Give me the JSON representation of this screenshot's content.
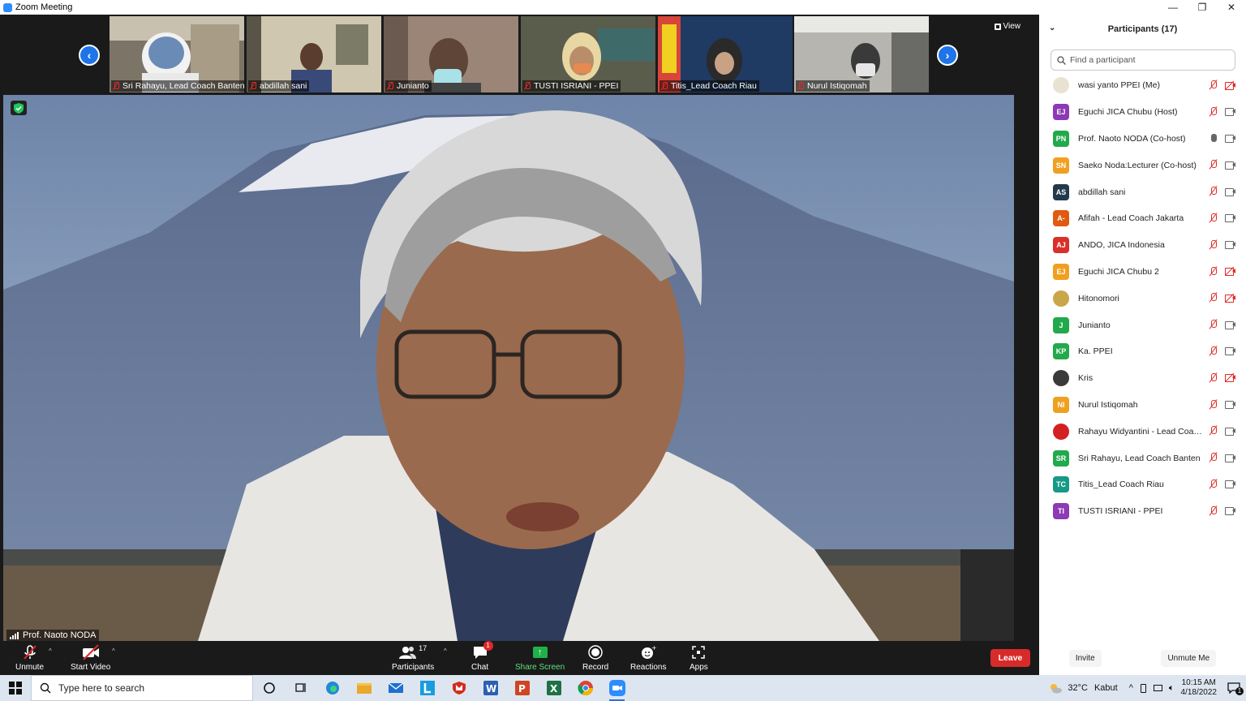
{
  "window": {
    "title": "Zoom Meeting",
    "controls": [
      "—",
      "❐",
      "✕"
    ]
  },
  "gallery": {
    "thumbnails": [
      {
        "name": "Sri Rahayu, Lead Coach Banten",
        "bg": "#8a7a6a"
      },
      {
        "name": "abdillah sani",
        "bg": "#a79a80"
      },
      {
        "name": "Junianto",
        "bg": "#8b7466"
      },
      {
        "name": "TUSTI ISRIANI - PPEI",
        "bg": "#6e6a58"
      },
      {
        "name": "Titis_Lead Coach Riau",
        "bg": "#2b4770"
      },
      {
        "name": "Nurul Istiqomah",
        "bg": "#9a9a98"
      }
    ],
    "view_label": "View"
  },
  "main_video": {
    "speaker": "Prof. Naoto NODA"
  },
  "toolbar": {
    "unmute": "Unmute",
    "start_video": "Start Video",
    "participants": "Participants",
    "participants_count": "17",
    "chat": "Chat",
    "chat_badge": "1",
    "share_screen": "Share Screen",
    "record": "Record",
    "reactions": "Reactions",
    "apps": "Apps",
    "leave": "Leave"
  },
  "participants_panel": {
    "title": "Participants (17)",
    "search_placeholder": "Find a participant",
    "invite": "Invite",
    "unmute_me": "Unmute Me",
    "people": [
      {
        "initials": "",
        "name": "wasi yanto PPEI (Me)",
        "color": "#e9e2d0",
        "mic": "off",
        "cam": "off"
      },
      {
        "initials": "EJ",
        "name": "Eguchi JICA Chubu (Host)",
        "color": "#8c3ab5",
        "mic": "off",
        "cam": "on"
      },
      {
        "initials": "PN",
        "name": "Prof. Naoto NODA (Co-host)",
        "color": "#22a94b",
        "mic": "on",
        "cam": "on"
      },
      {
        "initials": "SN",
        "name": "Saeko Noda:Lecturer (Co-host)",
        "color": "#f0a020",
        "mic": "off",
        "cam": "on"
      },
      {
        "initials": "AS",
        "name": "abdillah sani",
        "color": "#233a4d",
        "mic": "off",
        "cam": "on"
      },
      {
        "initials": "A-",
        "name": "Afifah - Lead Coach Jakarta",
        "color": "#e05a12",
        "mic": "off",
        "cam": "on"
      },
      {
        "initials": "AJ",
        "name": "ANDO, JICA Indonesia",
        "color": "#d9302a",
        "mic": "off",
        "cam": "on"
      },
      {
        "initials": "EJ",
        "name": "Eguchi JICA Chubu 2",
        "color": "#f0a020",
        "mic": "off",
        "cam": "off"
      },
      {
        "initials": "",
        "name": "Hitonomori",
        "color": "#c9a64a",
        "mic": "off",
        "cam": "off"
      },
      {
        "initials": "J",
        "name": "Junianto",
        "color": "#22a94b",
        "mic": "off",
        "cam": "on"
      },
      {
        "initials": "KP",
        "name": "Ka. PPEI",
        "color": "#22a94b",
        "mic": "off",
        "cam": "on"
      },
      {
        "initials": "",
        "name": "Kris",
        "color": "#3a3a3a",
        "mic": "off",
        "cam": "off"
      },
      {
        "initials": "NI",
        "name": "Nurul Istiqomah",
        "color": "#f0a020",
        "mic": "off",
        "cam": "on"
      },
      {
        "initials": "",
        "name": "Rahayu Widyantini - Lead Coach...",
        "color": "#d42020",
        "mic": "off",
        "cam": "on"
      },
      {
        "initials": "SR",
        "name": "Sri Rahayu, Lead Coach Banten",
        "color": "#22a94b",
        "mic": "off",
        "cam": "on"
      },
      {
        "initials": "TC",
        "name": "Titis_Lead Coach Riau",
        "color": "#169a86",
        "mic": "off",
        "cam": "on"
      },
      {
        "initials": "TI",
        "name": "TUSTI ISRIANI - PPEI",
        "color": "#8c3ab5",
        "mic": "off",
        "cam": "on"
      }
    ]
  },
  "taskbar": {
    "search_placeholder": "Type here to search",
    "weather_temp": "32°C",
    "weather_text": "Kabut",
    "time": "10:15 AM",
    "date": "4/18/2022",
    "notification_count": "1"
  }
}
